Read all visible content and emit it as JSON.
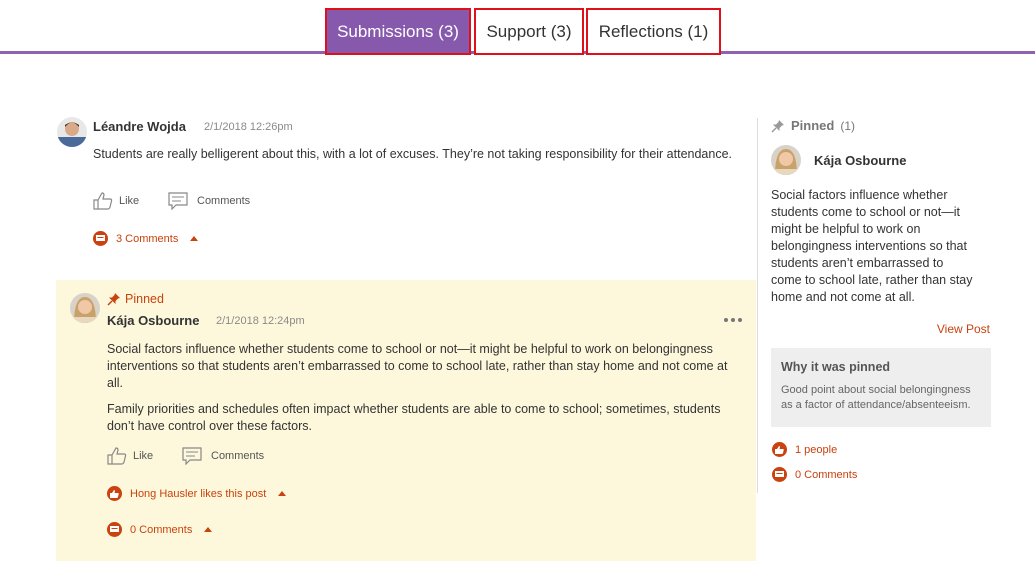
{
  "tabs": [
    {
      "label": "Submissions (3)",
      "active": true
    },
    {
      "label": "Support (3)",
      "active": false
    },
    {
      "label": "Reflections (1)",
      "active": false
    }
  ],
  "colors": {
    "accent": "#8759ad",
    "orange": "#c9420f",
    "highlight_border": "#e0101b",
    "pinned_bg": "#fdf8dc"
  },
  "post1": {
    "author": "Léandre Wojda",
    "timestamp": "2/1/2018 12:26pm",
    "body": "Students are really belligerent about this, with a lot of excuses. They’re not taking responsibility for their attendance.",
    "like_label": "Like",
    "comments_label": "Comments",
    "comments_count": "3 Comments"
  },
  "post2": {
    "pinned_label": "Pinned",
    "author": "Kája Osbourne",
    "timestamp": "2/1/2018 12:24pm",
    "more_icon": "ellipsis-icon",
    "body_p1": "Social factors influence whether students come to school or not—it might be helpful to work on belongingness interventions so that students aren’t embarrassed to come to school late, rather than stay home and not come at all.",
    "body_p2": "Family priorities and schedules often impact whether students are able to come to school; sometimes, students don’t have control over these factors.",
    "like_label": "Like",
    "comments_label": "Comments",
    "likes_text": "Hong Hausler likes this post",
    "comments_count": "0 Comments"
  },
  "sidebar": {
    "pinned_label": "Pinned",
    "pinned_count": "(1)",
    "author": "Kája Osbourne",
    "excerpt": "Social factors influence whether students come to school or not—it might be helpful to work on belongingness interventions so that students aren’t embarrassed to come to school late, rather than stay home and not come at all.",
    "view_post": "View Post",
    "why_title": "Why it was pinned",
    "why_body": "Good point about social belongingness as a factor of attendance/absenteeism.",
    "people_count": "1 people",
    "comments_count": "0 Comments"
  }
}
